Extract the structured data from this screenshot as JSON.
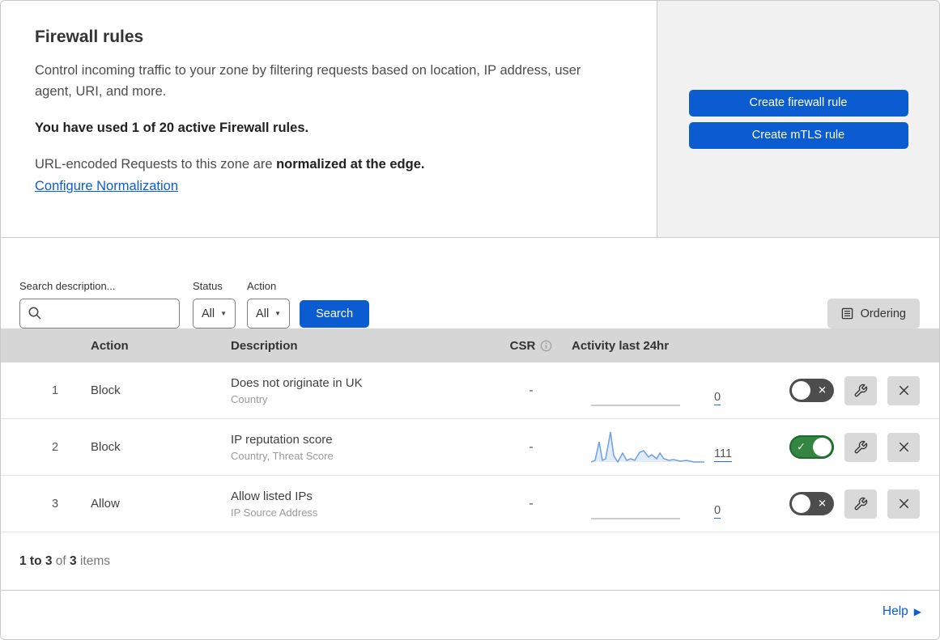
{
  "header": {
    "title": "Firewall rules",
    "description": "Control incoming traffic to your zone by filtering requests based on location, IP address, user agent, URI, and more.",
    "usage": "You have used 1 of 20 active Firewall rules.",
    "normalization_prefix": "URL-encoded Requests to this zone are ",
    "normalization_bold": "normalized at the edge.",
    "normalization_link": "Configure Normalization"
  },
  "actions_panel": {
    "create_firewall_rule_label": "Create firewall rule",
    "create_mtls_rule_label": "Create mTLS rule"
  },
  "filters": {
    "search_label": "Search description...",
    "status_label": "Status",
    "status_value": "All",
    "action_label": "Action",
    "action_value": "All",
    "search_button_label": "Search",
    "ordering_button_label": "Ordering",
    "caret_glyph": "▼"
  },
  "table": {
    "headers": {
      "action": "Action",
      "description": "Description",
      "csr": "CSR",
      "activity": "Activity last 24hr"
    },
    "rows": [
      {
        "priority": "1",
        "action": "Block",
        "description": "Does not originate in UK",
        "fields": "Country",
        "csr": "-",
        "activity_count": "0",
        "enabled": false,
        "sparkline_points": null
      },
      {
        "priority": "2",
        "action": "Block",
        "description": "IP reputation score",
        "fields": "Country, Threat Score",
        "csr": "-",
        "activity_count": "111",
        "enabled": true,
        "sparkline_points": [
          [
            0,
            40
          ],
          [
            5,
            38
          ],
          [
            10,
            15
          ],
          [
            14,
            38
          ],
          [
            18,
            36
          ],
          [
            24,
            3
          ],
          [
            28,
            32
          ],
          [
            33,
            40
          ],
          [
            39,
            29
          ],
          [
            44,
            38
          ],
          [
            49,
            36
          ],
          [
            54,
            38
          ],
          [
            60,
            28
          ],
          [
            65,
            26
          ],
          [
            71,
            34
          ],
          [
            75,
            31
          ],
          [
            81,
            36
          ],
          [
            85,
            29
          ],
          [
            90,
            36
          ],
          [
            96,
            38
          ],
          [
            102,
            37
          ],
          [
            110,
            39
          ],
          [
            118,
            38
          ],
          [
            127,
            40
          ],
          [
            140,
            40
          ]
        ]
      },
      {
        "priority": "3",
        "action": "Allow",
        "description": "Allow listed IPs",
        "fields": "IP Source Address",
        "csr": "-",
        "activity_count": "0",
        "enabled": false,
        "sparkline_points": null
      }
    ]
  },
  "footer": {
    "range_bold": "1 to 3",
    "of_text": " of ",
    "total_bold": "3",
    "items_text": " items"
  },
  "help": {
    "label": "Help",
    "arrow_glyph": "▶"
  },
  "icons": {
    "check": "✓",
    "cross": "✕"
  },
  "colors": {
    "accent_blue": "#0b5cd1",
    "toggle_on_green": "#358542",
    "toggle_off_gray": "#4d4d4d",
    "sparkline_blue": "#6d9ee8",
    "table_header_gray": "#d6d6d6",
    "actions_panel_gray": "#f1f1f1",
    "gray_button": "#d9d9d9"
  }
}
